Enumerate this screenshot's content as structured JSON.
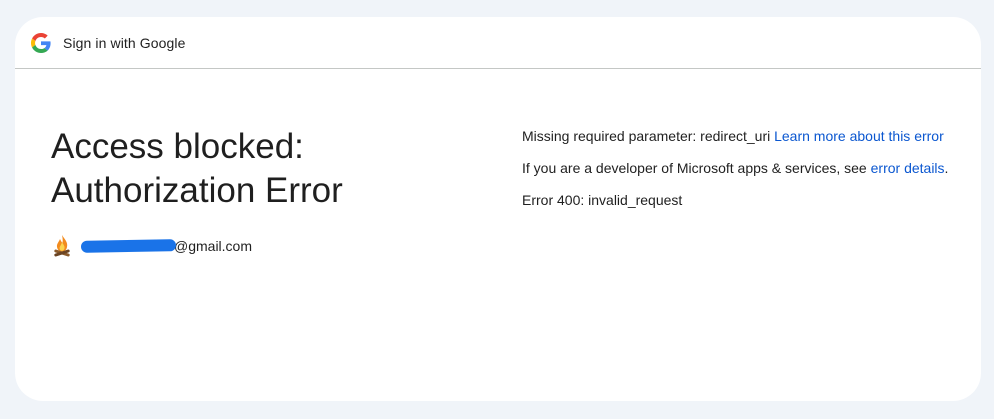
{
  "header": {
    "title": "Sign in with Google",
    "logo_icon": "google-g-icon",
    "brand_colors": {
      "blue": "#4285F4",
      "red": "#EA4335",
      "yellow": "#FBBC05",
      "green": "#34A853"
    }
  },
  "main": {
    "title_line1": "Access blocked:",
    "title_line2": "Authorization Error",
    "account": {
      "avatar_icon": "campfire-avatar-icon",
      "email_suffix": "@gmail.com"
    }
  },
  "details": {
    "missing_param_text": "Missing required parameter: redirect_uri ",
    "learn_more_link": "Learn more about this error",
    "developer_text": "If you are a developer of Microsoft apps & services, see ",
    "error_details_link": "error details",
    "developer_suffix": ".",
    "error_code": "Error 400: invalid_request"
  },
  "colors": {
    "background": "#f0f4f9",
    "card": "#ffffff",
    "link": "#0b57d0",
    "text": "#1f1f1f",
    "divider": "#c4c7c5"
  }
}
